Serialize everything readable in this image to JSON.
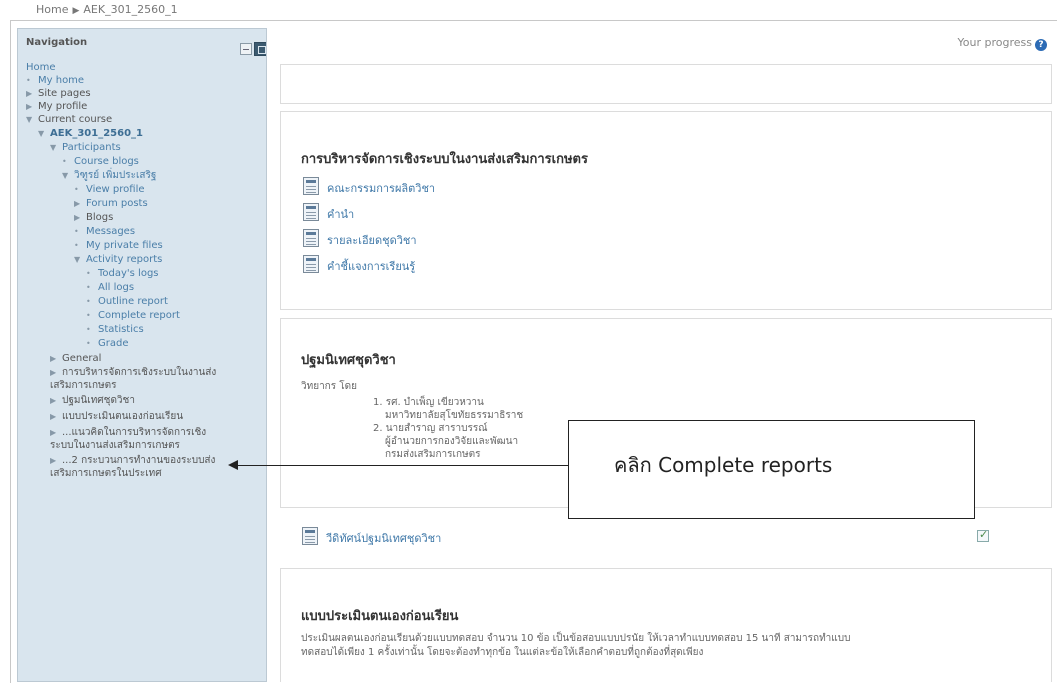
{
  "breadcrumb": {
    "home": "Home",
    "separator": "▶",
    "course": "AEK_301_2560_1"
  },
  "navigation": {
    "title": "Navigation",
    "items": [
      {
        "label": "Home",
        "marker": ""
      },
      {
        "label": "My home",
        "marker": "•"
      },
      {
        "label": "Site pages",
        "marker": "▶"
      },
      {
        "label": "My profile",
        "marker": "▶"
      },
      {
        "label": "Current course",
        "marker": "▼"
      },
      {
        "label": "AEK_301_2560_1",
        "marker": "▼"
      },
      {
        "label": "Participants",
        "marker": "▼"
      },
      {
        "label": "Course blogs",
        "marker": "•"
      },
      {
        "label": "วิฑูรย์ เพิ่มประเสริฐ",
        "marker": "▼"
      },
      {
        "label": "View profile",
        "marker": "•"
      },
      {
        "label": "Forum posts",
        "marker": "▶"
      },
      {
        "label": "Blogs",
        "marker": "▶"
      },
      {
        "label": "Messages",
        "marker": "•"
      },
      {
        "label": "My private files",
        "marker": "•"
      },
      {
        "label": "Activity reports",
        "marker": "▼"
      },
      {
        "label": "Today's logs",
        "marker": "•"
      },
      {
        "label": "All logs",
        "marker": "•"
      },
      {
        "label": "Outline report",
        "marker": "•"
      },
      {
        "label": "Complete report",
        "marker": "•"
      },
      {
        "label": "Statistics",
        "marker": "•"
      },
      {
        "label": "Grade",
        "marker": "•"
      },
      {
        "label": "General",
        "marker": "▶"
      },
      {
        "label": "การบริหารจัดการเชิงระบบในงานส่งเสริมการเกษตร",
        "marker": "▶"
      },
      {
        "label": "ปฐมนิเทศชุดวิชา",
        "marker": "▶"
      },
      {
        "label": "แบบประเมินตนเองก่อนเรียน",
        "marker": "▶"
      },
      {
        "label": "...แนวคิดในการบริหารจัดการเชิงระบบในงานส่งเสริมการเกษตร",
        "marker": "▶"
      },
      {
        "label": "...2 กระบวนการทำงานของระบบส่งเสริมการเกษตรในประเทศ",
        "marker": "▶"
      }
    ]
  },
  "progress": {
    "label": "Your progress",
    "help": "?"
  },
  "sections": {
    "course": {
      "title": "การบริหารจัดการเชิงระบบในงานส่งเสริมการเกษตร",
      "activities": [
        "คณะกรรมการผลิตวิชา",
        "คำนำ",
        "รายละเอียดชุดวิชา",
        "คำชี้แจงการเรียนรู้"
      ]
    },
    "orientation": {
      "title": "ปฐมนิเทศชุดวิชา",
      "lecturer_heading": "วิทยากร โดย",
      "lines": [
        "1. รศ. บำเพ็ญ เขียวหวาน",
        "มหาวิทยาลัยสุโขทัยธรรมาธิราช",
        "2. นายสำราญ สาราบรรณ์",
        "ผู้อำนวยการกองวิจัยและพัฒนา",
        "กรมส่งเสริมการเกษตร"
      ],
      "activity": "วีดิทัศน์ปฐมนิเทศชุดวิชา"
    },
    "pretest": {
      "title": "แบบประเมินตนเองก่อนเรียน",
      "description": [
        "ประเมินผลตนเองก่อนเรียนด้วยแบบทดสอบ จำนวน 10 ข้อ เป็นข้อสอบแบบปรนัย ให้เวลาทำแบบทดสอบ 15 นาที สามารถทำแบบ",
        "ทดสอบได้เพียง 1 ครั้งเท่านั้น โดยจะต้องทำทุกข้อ ในแต่ละข้อให้เลือกคำตอบที่ถูกต้องที่สุดเพียง"
      ]
    }
  },
  "callout": {
    "text": "คลิก Complete reports"
  }
}
